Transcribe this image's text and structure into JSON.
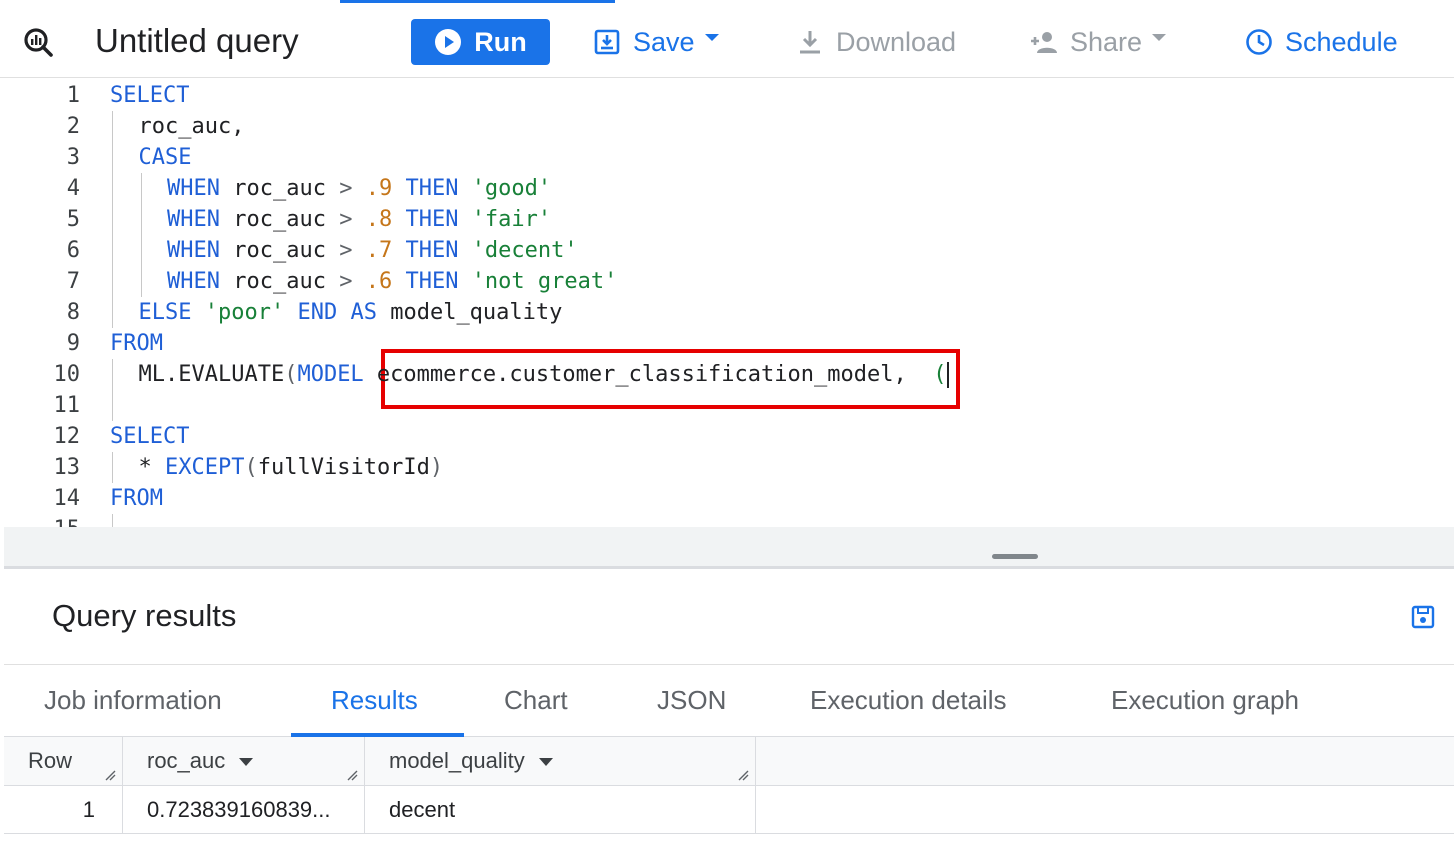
{
  "toolbar": {
    "title": "Untitled query",
    "run_label": "Run",
    "save_label": "Save",
    "download_label": "Download",
    "share_label": "Share",
    "schedule_label": "Schedule"
  },
  "editor": {
    "lines": [
      {
        "n": "1",
        "indent": 0,
        "tokens": [
          {
            "t": "SELECT",
            "c": "kw"
          }
        ]
      },
      {
        "n": "2",
        "indent": 1,
        "tokens": [
          {
            "t": "roc_auc,",
            "c": ""
          }
        ]
      },
      {
        "n": "3",
        "indent": 1,
        "tokens": [
          {
            "t": "CASE",
            "c": "kw"
          }
        ]
      },
      {
        "n": "4",
        "indent": 2,
        "tokens": [
          {
            "t": "WHEN",
            "c": "kw"
          },
          {
            "t": " roc_auc ",
            "c": ""
          },
          {
            "t": ">",
            "c": "paren"
          },
          {
            "t": " ",
            "c": ""
          },
          {
            "t": ".9",
            "c": "num"
          },
          {
            "t": " ",
            "c": ""
          },
          {
            "t": "THEN",
            "c": "kw"
          },
          {
            "t": " ",
            "c": ""
          },
          {
            "t": "'good'",
            "c": "str"
          }
        ]
      },
      {
        "n": "5",
        "indent": 2,
        "tokens": [
          {
            "t": "WHEN",
            "c": "kw"
          },
          {
            "t": " roc_auc ",
            "c": ""
          },
          {
            "t": ">",
            "c": "paren"
          },
          {
            "t": " ",
            "c": ""
          },
          {
            "t": ".8",
            "c": "num"
          },
          {
            "t": " ",
            "c": ""
          },
          {
            "t": "THEN",
            "c": "kw"
          },
          {
            "t": " ",
            "c": ""
          },
          {
            "t": "'fair'",
            "c": "str"
          }
        ]
      },
      {
        "n": "6",
        "indent": 2,
        "tokens": [
          {
            "t": "WHEN",
            "c": "kw"
          },
          {
            "t": " roc_auc ",
            "c": ""
          },
          {
            "t": ">",
            "c": "paren"
          },
          {
            "t": " ",
            "c": ""
          },
          {
            "t": ".7",
            "c": "num"
          },
          {
            "t": " ",
            "c": ""
          },
          {
            "t": "THEN",
            "c": "kw"
          },
          {
            "t": " ",
            "c": ""
          },
          {
            "t": "'decent'",
            "c": "str"
          }
        ]
      },
      {
        "n": "7",
        "indent": 2,
        "tokens": [
          {
            "t": "WHEN",
            "c": "kw"
          },
          {
            "t": " roc_auc ",
            "c": ""
          },
          {
            "t": ">",
            "c": "paren"
          },
          {
            "t": " ",
            "c": ""
          },
          {
            "t": ".6",
            "c": "num"
          },
          {
            "t": " ",
            "c": ""
          },
          {
            "t": "THEN",
            "c": "kw"
          },
          {
            "t": " ",
            "c": ""
          },
          {
            "t": "'not great'",
            "c": "str"
          }
        ]
      },
      {
        "n": "8",
        "indent": 1,
        "tokens": [
          {
            "t": "ELSE",
            "c": "kw"
          },
          {
            "t": " ",
            "c": ""
          },
          {
            "t": "'poor'",
            "c": "str"
          },
          {
            "t": " ",
            "c": ""
          },
          {
            "t": "END",
            "c": "kw"
          },
          {
            "t": " ",
            "c": ""
          },
          {
            "t": "AS",
            "c": "kw"
          },
          {
            "t": " model_quality",
            "c": ""
          }
        ]
      },
      {
        "n": "9",
        "indent": 0,
        "tokens": [
          {
            "t": "FROM",
            "c": "kw"
          }
        ]
      },
      {
        "n": "10",
        "indent": 1,
        "tokens": [
          {
            "t": "ML.EVALUATE",
            "c": ""
          },
          {
            "t": "(",
            "c": "paren"
          },
          {
            "t": "MODEL",
            "c": "kw"
          },
          {
            "t": " ecommerce.customer_classification_model,  ",
            "c": ""
          },
          {
            "t": "(",
            "c": "paren-g"
          }
        ],
        "cursor": true
      },
      {
        "n": "11",
        "indent": 1,
        "tokens": []
      },
      {
        "n": "12",
        "indent": 0,
        "tokens": [
          {
            "t": "SELECT",
            "c": "kw"
          }
        ]
      },
      {
        "n": "13",
        "indent": 1,
        "tokens": [
          {
            "t": "* ",
            "c": ""
          },
          {
            "t": "EXCEPT",
            "c": "kw"
          },
          {
            "t": "(",
            "c": "paren"
          },
          {
            "t": "fullVisitorId",
            "c": ""
          },
          {
            "t": ")",
            "c": "paren"
          }
        ]
      },
      {
        "n": "14",
        "indent": 0,
        "tokens": [
          {
            "t": "FROM",
            "c": "kw"
          }
        ]
      },
      {
        "n": "15",
        "indent": 1,
        "tokens": []
      }
    ]
  },
  "results": {
    "title": "Query results",
    "tabs": [
      {
        "label": "Job information",
        "active": false
      },
      {
        "label": "Results",
        "active": true
      },
      {
        "label": "Chart",
        "active": false
      },
      {
        "label": "JSON",
        "active": false
      },
      {
        "label": "Execution details",
        "active": false
      },
      {
        "label": "Execution graph",
        "active": false
      }
    ],
    "columns": [
      "Row",
      "roc_auc",
      "model_quality"
    ],
    "rows": [
      {
        "row": "1",
        "roc_auc": "0.723839160839...",
        "model_quality": "decent"
      }
    ]
  },
  "colors": {
    "accent": "#1a73e8",
    "keyword": "#1f5fd6",
    "string": "#188038",
    "number": "#c5761a",
    "highlight": "#e60000"
  }
}
